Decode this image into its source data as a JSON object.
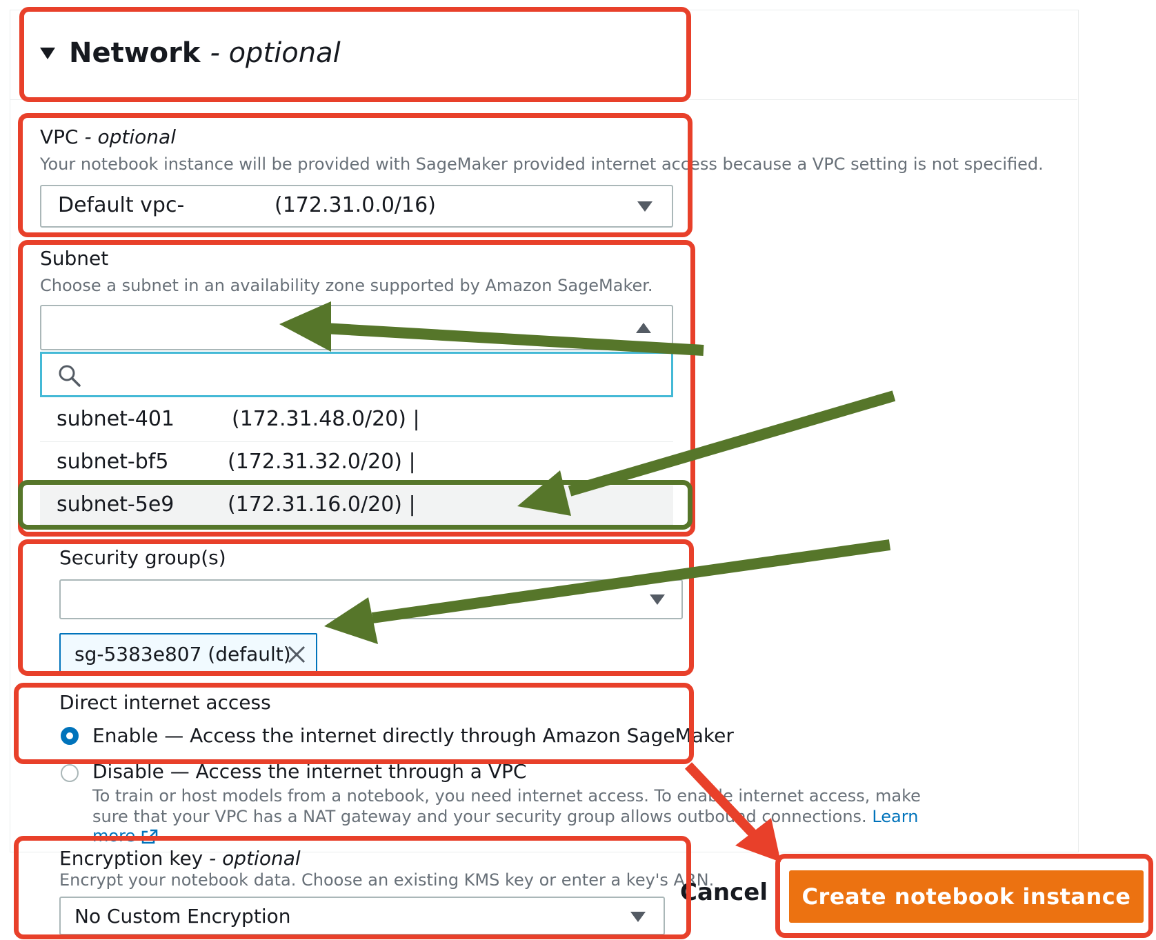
{
  "network": {
    "title": "Network",
    "title_suffix": "- optional"
  },
  "vpc": {
    "label": "VPC",
    "label_suffix": "- optional",
    "description": "Your notebook instance will be provided with SageMaker provided internet access because a VPC setting is not specified.",
    "value": "Default vpc-",
    "value_cidr": "(172.31.0.0/16)"
  },
  "subnet": {
    "label": "Subnet",
    "description": "Choose a subnet in an availability zone supported by Amazon SageMaker.",
    "search_placeholder": "",
    "options": [
      {
        "id": "subnet-401",
        "cidr": "(172.31.48.0/20) |",
        "selected": false
      },
      {
        "id": "subnet-bf5",
        "cidr": "(172.31.32.0/20) |",
        "selected": false
      },
      {
        "id": "subnet-5e9",
        "cidr": "(172.31.16.0/20) |",
        "selected": true
      }
    ]
  },
  "security_groups": {
    "label": "Security group(s)",
    "token": "sg-5383e807 (default)"
  },
  "direct_internet": {
    "label": "Direct internet access",
    "enable_option": "Enable — Access the internet directly through Amazon SageMaker",
    "disable_option": "Disable — Access the internet through a VPC",
    "help_line1": "To train or host models from a notebook, you need internet access. To enable internet access, make",
    "help_line2": "sure that your VPC has a NAT gateway and your security group allows outbound connections.",
    "learn_link": "Learn",
    "learn_more": "more"
  },
  "encryption": {
    "label": "Encryption key",
    "label_suffix": "- optional",
    "description": "Encrypt your notebook data. Choose an existing KMS key or enter a key's ARN.",
    "value": "No Custom Encryption"
  },
  "footer": {
    "cancel_label": "Cancel",
    "create_label": "Create notebook instance"
  },
  "colors": {
    "annotation_red": "#e8402a",
    "annotation_green": "#56762a",
    "primary_orange": "#ec7211",
    "link_blue": "#0073bb"
  },
  "icons": {
    "section_toggle": "caret-down-icon",
    "search": "search-icon",
    "remove_token": "close-icon",
    "selected_indicator": "radio-selected-icon"
  }
}
